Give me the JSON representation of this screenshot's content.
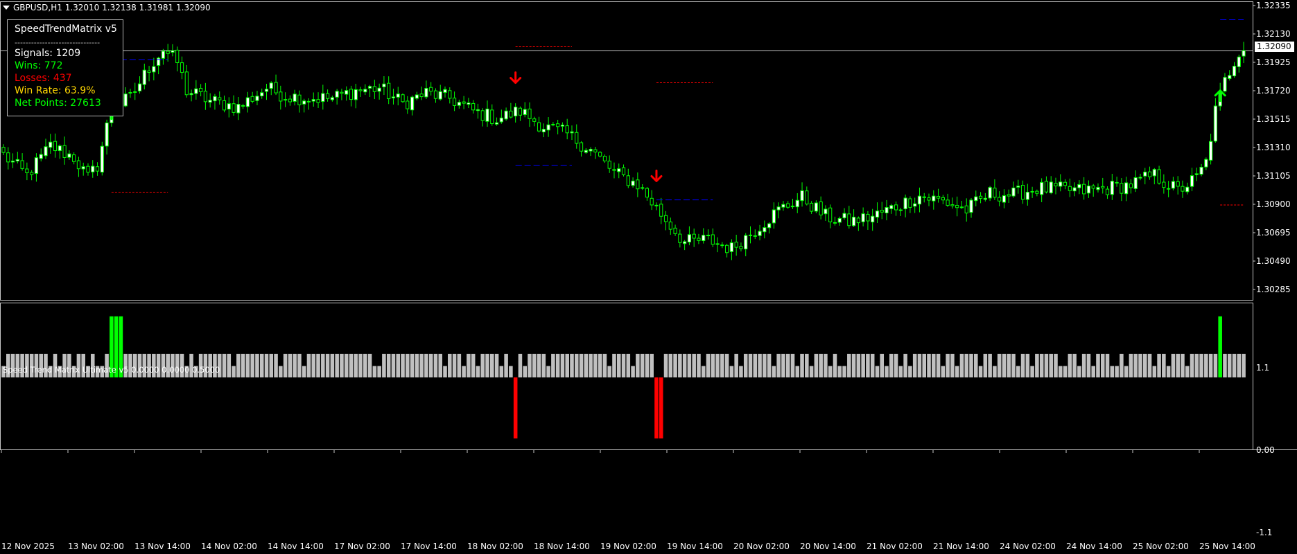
{
  "header": {
    "symbol_text": "GBPUSD,H1  1.32010 1.32138 1.31981 1.32090"
  },
  "info_panel": {
    "title": "SpeedTrendMatrix v5",
    "separator": "-------------------------------",
    "signals": "Signals: 1209",
    "wins": "Wins: 772",
    "losses": "Losses: 437",
    "win_rate": "Win Rate: 63.9%",
    "net_points": "Net Points: 27613"
  },
  "indicator": {
    "label": "Speed Trend Matrix Ultimate v5 0.0000 0.0000 0.5000",
    "axis_labels": [
      "1.1",
      "0.00",
      "-1.1"
    ]
  },
  "price_axis": {
    "labels": [
      "1.32335",
      "1.32130",
      "1.31925",
      "1.31720",
      "1.31515",
      "1.31310",
      "1.31105",
      "1.30900",
      "1.30695",
      "1.30490",
      "1.30285"
    ],
    "current_price": "1.32090"
  },
  "time_axis": {
    "labels": [
      "12 Nov 2025",
      "13 Nov 02:00",
      "13 Nov 14:00",
      "14 Nov 02:00",
      "14 Nov 14:00",
      "17 Nov 02:00",
      "17 Nov 14:00",
      "18 Nov 02:00",
      "18 Nov 14:00",
      "19 Nov 02:00",
      "19 Nov 14:00",
      "20 Nov 02:00",
      "20 Nov 14:00",
      "21 Nov 02:00",
      "21 Nov 14:00",
      "24 Nov 02:00",
      "24 Nov 14:00",
      "25 Nov 02:00",
      "25 Nov 14:00"
    ]
  },
  "colors": {
    "background": "#000000",
    "bull_candle": "#00ff00",
    "bear_candle": "#00ff00",
    "bull_body": "#ffffff",
    "bear_body": "#000000",
    "buy_arrow": "#00ff00",
    "sell_arrow": "#ff0000",
    "histogram_neutral": "#c0c0c0",
    "histogram_buy": "#00ff00",
    "histogram_sell": "#ff0000",
    "take_profit_line": "#ff0000",
    "stop_line": "#0000ff",
    "wins_text": "#00ff00",
    "losses_text": "#ff0000",
    "win_rate_text": "#ffd700",
    "net_points_text": "#00ff00"
  },
  "chart_data": {
    "type": "candlestick",
    "symbol": "GBPUSD",
    "timeframe": "H1",
    "ylim": [
      1.3018,
      1.3244
    ],
    "current_price": 1.3209,
    "close_path": [
      [
        0,
        1.3128
      ],
      [
        5,
        1.3112
      ],
      [
        10,
        1.3135
      ],
      [
        15,
        1.3126
      ],
      [
        18,
        1.311
      ],
      [
        20,
        1.312
      ],
      [
        23,
        1.3165
      ],
      [
        27,
        1.3172
      ],
      [
        31,
        1.3196
      ],
      [
        34,
        1.321
      ],
      [
        37,
        1.32
      ],
      [
        39,
        1.3178
      ],
      [
        44,
        1.317
      ],
      [
        50,
        1.3165
      ],
      [
        56,
        1.318
      ],
      [
        60,
        1.3174
      ],
      [
        65,
        1.3172
      ],
      [
        70,
        1.3172
      ],
      [
        75,
        1.3178
      ],
      [
        80,
        1.318
      ],
      [
        85,
        1.3168
      ],
      [
        90,
        1.3176
      ],
      [
        95,
        1.3172
      ],
      [
        100,
        1.3162
      ],
      [
        105,
        1.3156
      ],
      [
        110,
        1.3162
      ],
      [
        115,
        1.315
      ],
      [
        120,
        1.3144
      ],
      [
        125,
        1.3132
      ],
      [
        130,
        1.3114
      ],
      [
        135,
        1.3105
      ],
      [
        140,
        1.3082
      ],
      [
        145,
        1.306
      ],
      [
        150,
        1.3062
      ],
      [
        155,
        1.3055
      ],
      [
        160,
        1.307
      ],
      [
        165,
        1.3085
      ],
      [
        170,
        1.3095
      ],
      [
        175,
        1.308
      ],
      [
        180,
        1.3076
      ],
      [
        185,
        1.308
      ],
      [
        190,
        1.3088
      ],
      [
        195,
        1.3096
      ],
      [
        200,
        1.3092
      ],
      [
        205,
        1.3085
      ],
      [
        210,
        1.3098
      ],
      [
        215,
        1.3097
      ],
      [
        220,
        1.3102
      ],
      [
        225,
        1.3101
      ],
      [
        230,
        1.31
      ],
      [
        235,
        1.3102
      ],
      [
        240,
        1.3105
      ],
      [
        245,
        1.3112
      ],
      [
        250,
        1.31
      ],
      [
        254,
        1.311
      ],
      [
        256,
        1.3122
      ],
      [
        258,
        1.3162
      ],
      [
        260,
        1.3185
      ],
      [
        263,
        1.3209
      ]
    ],
    "signals": [
      {
        "type": "buy",
        "index": 23
      },
      {
        "type": "sell",
        "index": 109
      },
      {
        "type": "sell",
        "index": 139
      },
      {
        "type": "buy",
        "index": 259
      }
    ],
    "levels": [
      {
        "kind": "take_profit",
        "start": 23,
        "end": 35,
        "price": 1.3099
      },
      {
        "kind": "stop",
        "start": 23,
        "end": 35,
        "price": 1.3202
      },
      {
        "kind": "take_profit",
        "start": 109,
        "end": 121,
        "price": 1.3212
      },
      {
        "kind": "stop",
        "start": 109,
        "end": 121,
        "price": 1.312
      },
      {
        "kind": "take_profit",
        "start": 139,
        "end": 151,
        "price": 1.3184
      },
      {
        "kind": "stop",
        "start": 139,
        "end": 151,
        "price": 1.3093
      },
      {
        "kind": "take_profit",
        "start": 259,
        "end": 264,
        "price": 1.3089
      },
      {
        "kind": "stop",
        "start": 259,
        "end": 264,
        "price": 1.3233
      }
    ],
    "histogram": {
      "range": [
        -1.1,
        1.1
      ],
      "neutral_levels": [
        0.5,
        0.3
      ],
      "buy_bars": [
        23,
        24,
        25,
        259
      ],
      "sell_bars": [
        109,
        139,
        140
      ],
      "buy_value": 1.0,
      "sell_value": -1.0
    }
  }
}
